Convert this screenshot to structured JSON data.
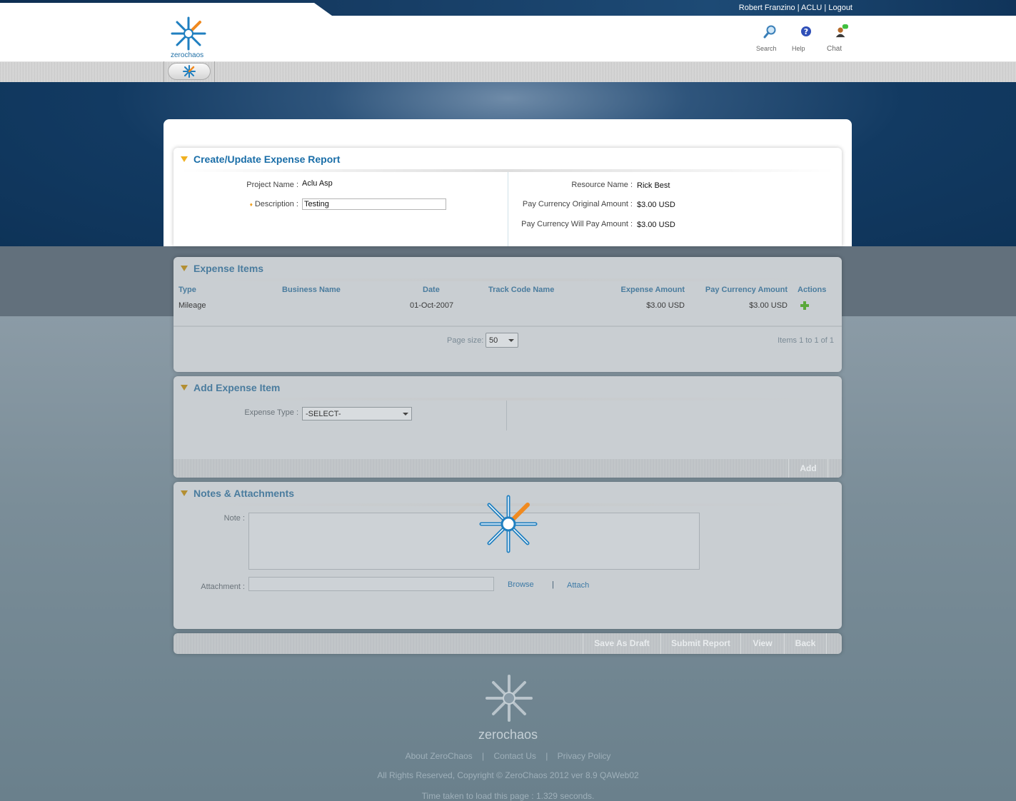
{
  "top_bar": {
    "user_name": "Robert Franzino",
    "separator": "|",
    "client": "ACLU",
    "logout_label": "Logout"
  },
  "header": {
    "logo_text": "zerochaos",
    "search_label": "Search",
    "help_label": "Help",
    "chat_label": "Chat"
  },
  "report": {
    "title": "Create/Update Expense Report",
    "project_name_label": "Project Name :",
    "project_name": "Aclu Asp",
    "description_label": "Description :",
    "description_value": "Testing",
    "resource_name_label": "Resource Name :",
    "resource_name": "Rick Best",
    "original_amount_label": "Pay Currency Original Amount :",
    "original_amount": "$3.00 USD",
    "will_pay_label": "Pay Currency Will Pay Amount :",
    "will_pay_amount": "$3.00 USD"
  },
  "expense_items": {
    "title": "Expense Items",
    "columns": [
      "Type",
      "Business Name",
      "Date",
      "Track Code Name",
      "Expense Amount",
      "Pay Currency Amount",
      "Actions"
    ],
    "rows": [
      {
        "type": "Mileage",
        "business_name": "",
        "date": "01-Oct-2007",
        "track_code": "",
        "expense_amount": "$3.00 USD",
        "pay_currency_amount": "$3.00 USD"
      }
    ],
    "page_size_label": "Page size:",
    "page_size": "50",
    "items_info": "Items 1 to 1 of 1"
  },
  "add_item": {
    "title": "Add Expense Item",
    "expense_type_label": "Expense Type :",
    "expense_type_value": "-SELECT-",
    "add_label": "Add"
  },
  "notes": {
    "title": "Notes & Attachments",
    "note_label": "Note :",
    "attachment_label": "Attachment :",
    "browse_label": "Browse",
    "separator": "|",
    "attach_label": "Attach"
  },
  "actions": {
    "save_draft": "Save As Draft",
    "submit": "Submit Report",
    "view": "View",
    "back": "Back"
  },
  "footer": {
    "logo_text": "zerochaos",
    "about": "About ZeroChaos",
    "contact": "Contact Us",
    "privacy": "Privacy Policy",
    "sep": "|",
    "copyright": "All Rights Reserved, Copyright © ZeroChaos 2012 ver 8.9 QAWeb02",
    "load_time": "Time taken to load this page : 1.329 seconds."
  },
  "colors": {
    "brand_blue": "#1f6fa6",
    "accent_orange": "#f0a020",
    "banner_navy": "#0e3358"
  }
}
